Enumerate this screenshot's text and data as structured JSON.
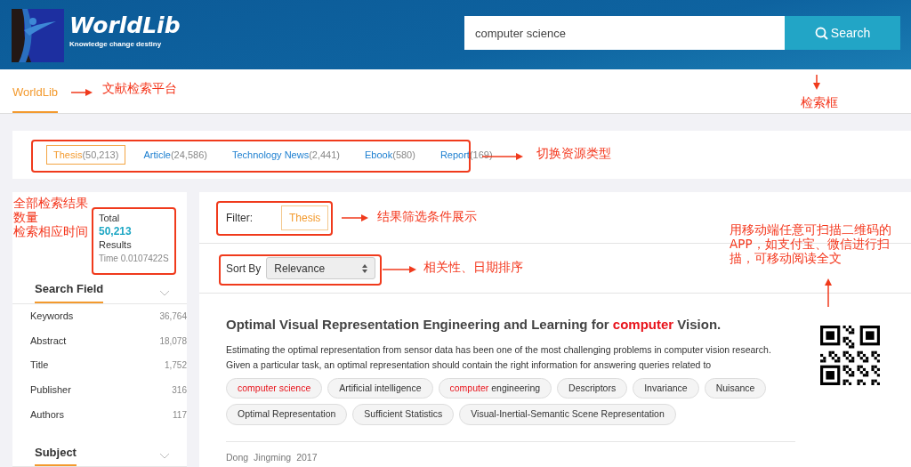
{
  "header": {
    "logo_title": "WorldLib",
    "logo_tagline": "Knowledge change destiny",
    "search": {
      "value": "computer science",
      "button": "Search"
    }
  },
  "nav": [
    {
      "label": "WorldLib",
      "selected": true
    }
  ],
  "resource_tabs": [
    {
      "label": "Thesis",
      "count": "(50,213)",
      "selected": true
    },
    {
      "label": "Article",
      "count": "(24,586)",
      "selected": false
    },
    {
      "label": "Technology News",
      "count": "(2,441)",
      "selected": false
    },
    {
      "label": "Ebook",
      "count": "(580)",
      "selected": false
    },
    {
      "label": "Report",
      "count": "(169)",
      "selected": false
    }
  ],
  "summary": {
    "total_label": "Total",
    "total": "50,213",
    "results_label": "Results",
    "time": "Time 0.0107422S"
  },
  "facets": [
    {
      "title": "Search Field",
      "items": [
        {
          "label": "Keywords",
          "count": "36,764"
        },
        {
          "label": "Abstract",
          "count": "18,078"
        },
        {
          "label": "Title",
          "count": "1,752"
        },
        {
          "label": "Publisher",
          "count": "316"
        },
        {
          "label": "Authors",
          "count": "117"
        }
      ]
    },
    {
      "title": "Subject"
    }
  ],
  "filter": {
    "label": "Filter:",
    "chips": [
      "Thesis"
    ]
  },
  "sort": {
    "label": "Sort By",
    "value": "Relevance"
  },
  "results": [
    {
      "title": "Optimal Visual Representation Engineering and Learning for *computer* Vision.",
      "abstract": "Estimating the optimal representation from sensor data has been one of the most challenging problems in computer vision research. Given a particular task, an optimal representation should contain the right information for answering queries related to",
      "tags": [
        "*computer science*",
        "Artificial intelligence",
        "*computer* engineering",
        "Descriptors",
        "Invariance",
        "Nuisance",
        "Optimal Representation",
        "Sufficient Statistics",
        "Visual-Inertial-Semantic Scene Representation"
      ],
      "authors": [
        "Dong",
        "Jingming"
      ],
      "year": "2017"
    }
  ],
  "annotations": [
    {
      "lines": [
        "文献检索平台"
      ]
    },
    {
      "lines": [
        "检索框"
      ]
    },
    {
      "lines": [
        "切换资源类型"
      ]
    },
    {
      "lines": [
        "全部检索结果",
        "数量",
        "检索相应时间"
      ]
    },
    {
      "lines": [
        "结果筛选条件展示"
      ]
    },
    {
      "lines": [
        "相关性、日期排序"
      ]
    },
    {
      "lines": [
        "用移动端任意可扫描二维码的",
        "APP，如支付宝、微信进行扫",
        "描，可移动阅读全文"
      ]
    }
  ]
}
